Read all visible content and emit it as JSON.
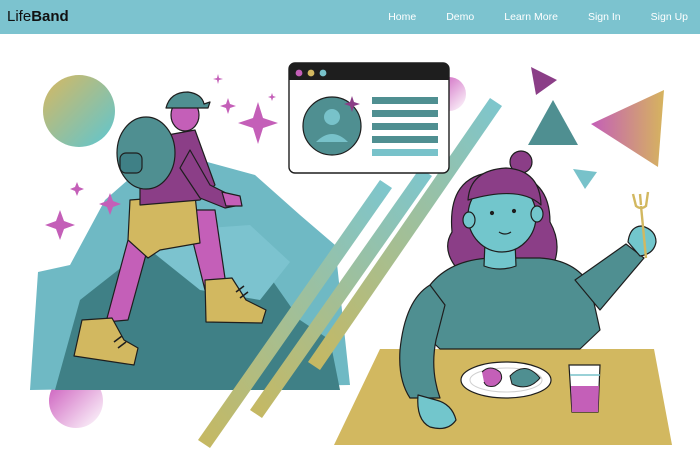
{
  "brand": {
    "prefix": "Life",
    "suffix": "Band"
  },
  "nav": {
    "items": [
      {
        "label": "Home"
      },
      {
        "label": "Demo"
      },
      {
        "label": "Learn More"
      },
      {
        "label": "Sign In"
      },
      {
        "label": "Sign Up"
      }
    ]
  },
  "colors": {
    "navbar": "#7cc3cf",
    "teal_dark": "#4f8f91",
    "teal_light": "#78c2ca",
    "magenta": "#c45fb8",
    "mustard": "#d2b860",
    "plum": "#8b3e87",
    "skin": "#72c6cc",
    "outline": "#1e1e1e"
  },
  "illustration": {
    "icons": [
      "hiker",
      "mountain",
      "profile-card",
      "woman-eating",
      "fork",
      "drink-glass",
      "shrimp-plate",
      "sparkles",
      "triangles",
      "gradient-orbs",
      "diagonal-stripes"
    ]
  }
}
